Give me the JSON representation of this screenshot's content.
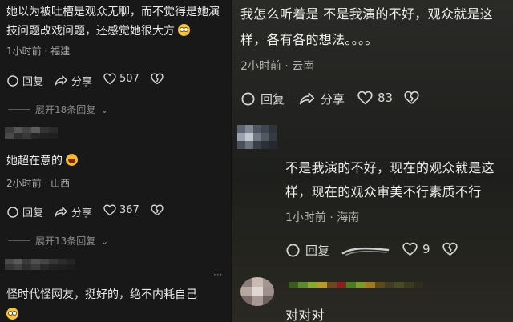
{
  "left": {
    "comment1": {
      "line1": "她以为被吐槽是观众无聊，而不觉得是她演",
      "line2": "技问题改戏问题，还感觉她很大方",
      "meta": "1小时前 · 福建",
      "reply": "回复",
      "share": "分享",
      "likes": "507",
      "expand": "展开18条回复"
    },
    "comment2": {
      "text": "她超在意的",
      "meta": "2小时前 · 山西",
      "reply": "回复",
      "share": "分享",
      "likes": "367",
      "expand": "展开13条回复"
    },
    "comment3": {
      "text": "怪时代怪网友，挺好的，绝不内耗自己"
    }
  },
  "right": {
    "comment1": {
      "line1": "我怎么听着是 不是我演的不好，观众就是这",
      "line2": "样，各有各的想法。。。。",
      "meta": "2小时前 · 云南",
      "reply": "回复",
      "share": "分享",
      "likes": "83"
    },
    "comment2": {
      "line1": "不是我演的不好，现在的观众就是这",
      "line2": "样，现在的观众审美不行素质不行",
      "meta": "1小时前 · 海南",
      "reply": "回复",
      "likes": "9"
    },
    "comment3": {
      "text": "对对对"
    }
  },
  "colors": {
    "background_left": "#181818",
    "text_primary": "#ececec",
    "text_meta": "#a9a9a9"
  }
}
